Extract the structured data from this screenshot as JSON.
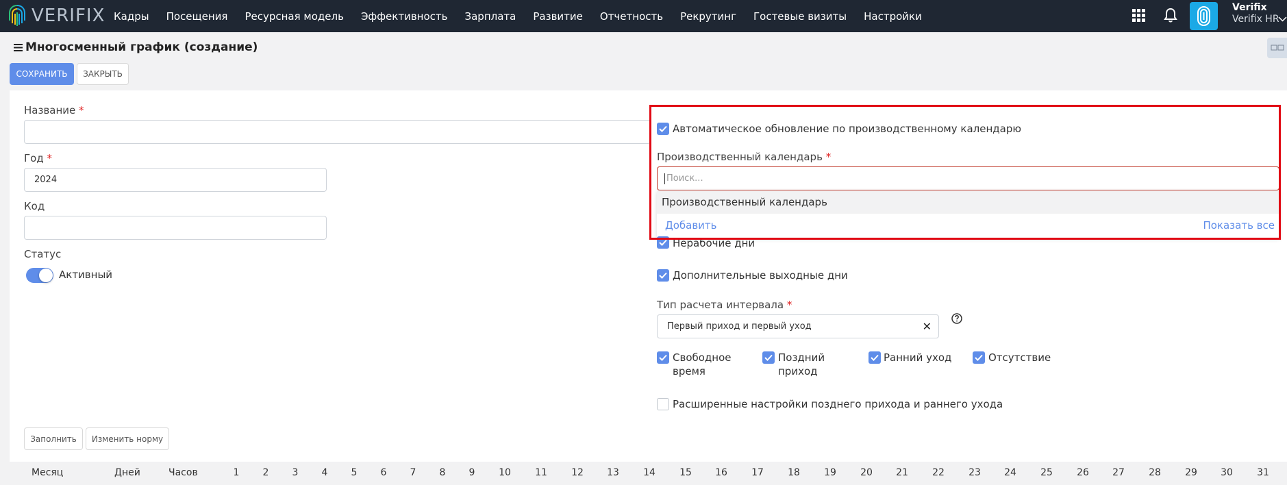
{
  "app": {
    "brand": "VERIFIX",
    "nav": [
      "Кадры",
      "Посещения",
      "Ресурсная модель",
      "Эффективность",
      "Зарплата",
      "Развитие",
      "Отчетность",
      "Рекрутинг",
      "Гостевые визиты",
      "Настройки"
    ],
    "user_name": "Verifix",
    "user_sub": "Verifix HR",
    "colors": {
      "topbar": "#1f2733",
      "accent": "#5f8de9",
      "avatar": "#1ba9e6",
      "highlight": "#e10a14"
    }
  },
  "page": {
    "title": "Многосменный график (создание)",
    "save_label": "СОХРАНИТЬ",
    "close_label": "ЗАКРЫТЬ"
  },
  "form": {
    "name_label": "Название",
    "name_value": "",
    "year_label": "Год",
    "year_value": "2024",
    "code_label": "Код",
    "code_value": "",
    "status_label": "Статус",
    "status_value": "Активный",
    "required_mark": "*"
  },
  "right": {
    "auto_update_label": "Автоматическое обновление по производственному календарю",
    "calendar_label": "Производственный календарь",
    "calendar_placeholder": "Поиск...",
    "calendar_option": "Производственный календарь",
    "add_label": "Добавить",
    "show_all_label": "Показать все",
    "nonworking_label": "Нерабочие дни",
    "extra_days_label": "Дополнительные выходные дни",
    "interval_label": "Тип расчета интервала",
    "interval_value": "Первый приход и первый уход",
    "check_free_time_1": "Свободное",
    "check_free_time_2": "время",
    "check_late_1": "Поздний",
    "check_late_2": "приход",
    "check_early": "Ранний уход",
    "check_absence": "Отсутствие",
    "advanced_label": "Расширенные настройки позднего прихода и раннего ухода"
  },
  "actions": {
    "fill_label": "Заполнить",
    "change_norm_label": "Изменить норму"
  },
  "table": {
    "columns": [
      "Месяц",
      "Дней",
      "Часов"
    ],
    "days": [
      "1",
      "2",
      "3",
      "4",
      "5",
      "6",
      "7",
      "8",
      "9",
      "10",
      "11",
      "12",
      "13",
      "14",
      "15",
      "16",
      "17",
      "18",
      "19",
      "20",
      "21",
      "22",
      "23",
      "24",
      "25",
      "26",
      "27",
      "28",
      "29",
      "30",
      "31"
    ]
  }
}
